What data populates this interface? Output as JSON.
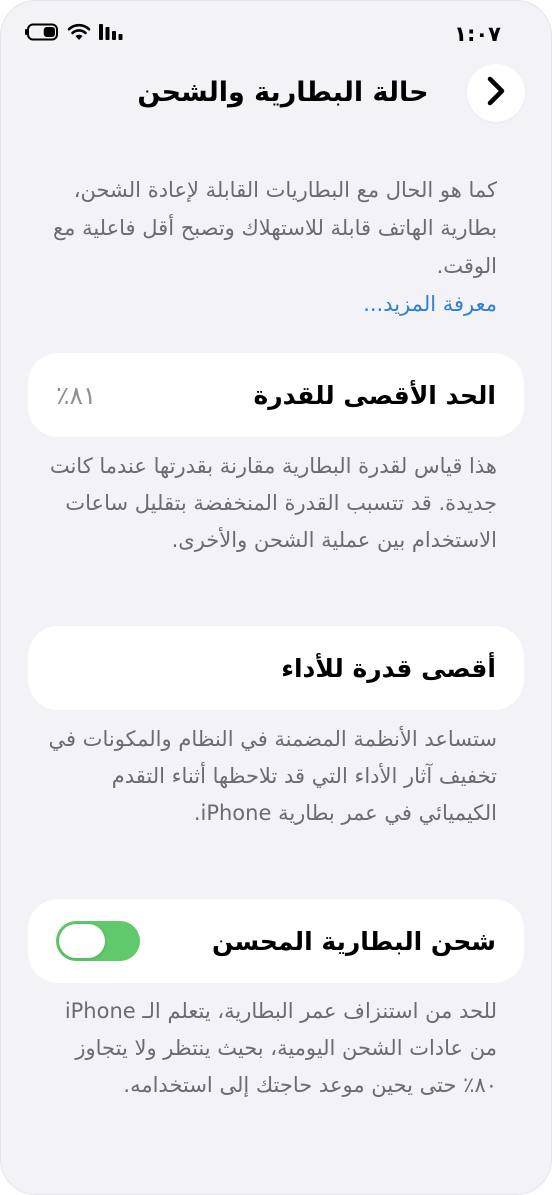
{
  "status_bar": {
    "time": "١:٠٧",
    "icons": [
      "battery-icon",
      "wifi-icon",
      "cellular-signal-icon"
    ],
    "battery_level": 0.45
  },
  "nav": {
    "title": "حالة البطارية والشحن",
    "back_icon": "chevron-icon"
  },
  "intro": {
    "text": "كما هو الحال مع البطاريات القابلة لإعادة الشحن، بطارية الهاتف قابلة للاستهلاك وتصبح أقل فاعلية مع الوقت.",
    "link": "معرفة المزيد..."
  },
  "max_capacity": {
    "title": "الحد الأقصى للقدرة",
    "value": "٨١٪",
    "note": "هذا قياس لقدرة البطارية مقارنة بقدرتها عندما كانت جديدة. قد تتسبب القدرة المنخفضة بتقليل ساعات الاستخدام بين عملية الشحن والأخرى."
  },
  "peak_performance": {
    "title": "أقصى قدرة للأداء",
    "note": "ستساعد الأنظمة المضمنة في النظام والمكونات في تخفيف آثار الأداء التي قد تلاحظها أثناء التقدم الكيميائي في عمر بطارية iPhone."
  },
  "optimized_charging": {
    "title": "شحن البطارية المحسن",
    "enabled": true,
    "note": "للحد من استنزاف عمر البطارية، يتعلم الـ iPhone من عادات الشحن اليومية، بحيث ينتظر ولا يتجاوز ٨٠٪ حتى يحين موعد حاجتك إلى استخدامه."
  },
  "colors": {
    "background": "#f2f2f7",
    "card": "#ffffff",
    "link": "#2f7fd1",
    "toggle_on": "#5fc96b",
    "secondary_text": "#6b6b70"
  }
}
